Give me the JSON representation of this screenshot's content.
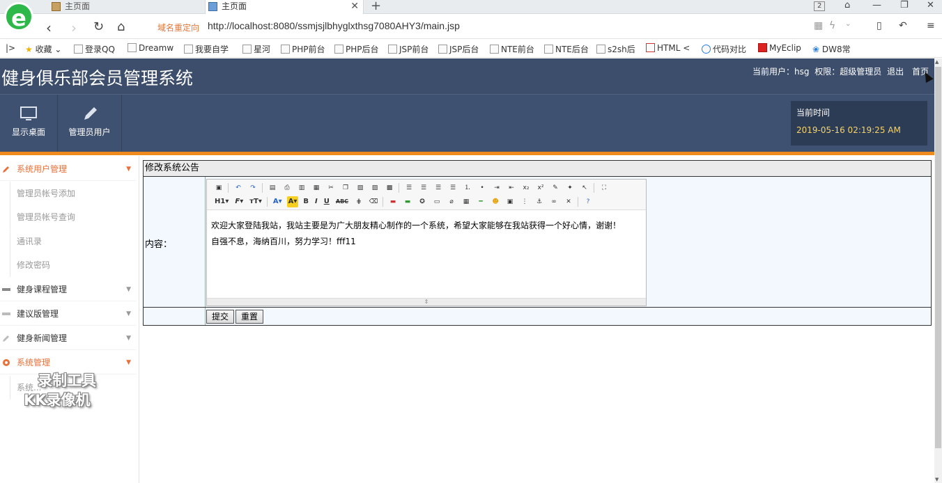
{
  "browser": {
    "tabs": [
      {
        "title": "主页面"
      },
      {
        "title": "主页面"
      }
    ],
    "tab_count": "2",
    "redirect_label": "域名重定向",
    "url": "http://localhost:8080/ssmjsjlbhyglxthsg7080AHY3/main.jsp",
    "bookmarks": [
      "收藏",
      "登录QQ",
      "Dreamw",
      "我要自学",
      "星河",
      "PHP前台",
      "PHP后台",
      "JSP前台",
      "JSP后台",
      "NTE前台",
      "NTE后台",
      "s2sh后",
      "HTML <",
      "代码对比",
      "MyEclip",
      "DW8常"
    ]
  },
  "app": {
    "title": "健身俱乐部会员管理系统",
    "user_label": "当前用户：hsg",
    "role_label": "权限：超级管理员",
    "logout": "退出",
    "home": "首页",
    "quick_buttons": [
      "显示桌面",
      "管理员用户"
    ],
    "time_label": "当前时间",
    "time_value": "2019-05-16 02:19:25 AM"
  },
  "sidebar": {
    "groups": [
      {
        "label": "系统用户管理",
        "active": true,
        "items": [
          "管理员帐号添加",
          "管理员帐号查询",
          "通讯录",
          "修改密码"
        ]
      },
      {
        "label": "健身课程管理"
      },
      {
        "label": "建议版管理"
      },
      {
        "label": "健身新闻管理"
      },
      {
        "label": "系统管理",
        "active": true,
        "items": [
          "系统..."
        ]
      }
    ]
  },
  "form": {
    "title": "修改系统公告",
    "content_label": "内容：",
    "content_lines": [
      "欢迎大家登陆我站，我站主要是为广大朋友精心制作的一个系统，希望大家能够在我站获得一个好心情，谢谢！",
      "自强不息，海纳百川，努力学习！fff11"
    ],
    "submit": "提交",
    "reset": "重置"
  },
  "watermark": {
    "line1": "录制工具",
    "line2": "KK录像机"
  },
  "colors": {
    "header": "#3c4e6b",
    "accent": "#f08a1c",
    "active_menu": "#e8703a",
    "time": "#f5d36b"
  }
}
